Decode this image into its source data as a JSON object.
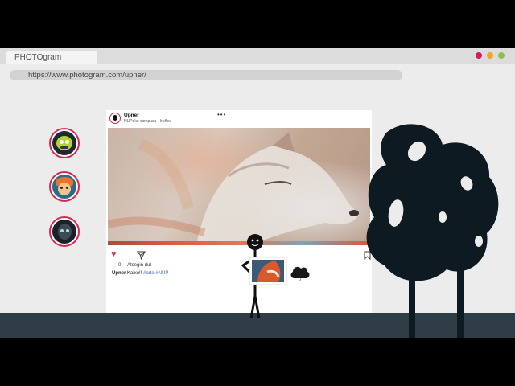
{
  "browser": {
    "tab_title": "PHOTOgram",
    "url": "https://www.photogram.com/upner/",
    "window_dots": [
      "#d81b60",
      "#f4a51c",
      "#8bc34a"
    ]
  },
  "stories": [
    {
      "name": "story-1",
      "accent": "#8bc34a"
    },
    {
      "name": "story-2",
      "accent": "#f4a51c"
    },
    {
      "name": "story-3",
      "accent": "#3a4a55"
    }
  ],
  "post": {
    "username": "Upner",
    "location": "NUPeko campusa - Iruñea",
    "menu": "•••",
    "likes_count": "0",
    "likes_label": "Atsegin dut",
    "caption_user": "Upner",
    "caption_text": "Kaixo!!",
    "caption_tags": "#arte #NUP"
  },
  "icons": {
    "like": "heart-icon",
    "share": "send-icon",
    "bookmark": "bookmark-icon",
    "home": "home-icon",
    "search": "search-icon",
    "post": "add-post-icon",
    "activity": "heart-icon",
    "profile": "profile-icon"
  },
  "upload": {
    "count": "0"
  },
  "colors": {
    "accent": "#d42a52",
    "ground": "#2f3d47",
    "silhouette": "#0e1a22"
  }
}
